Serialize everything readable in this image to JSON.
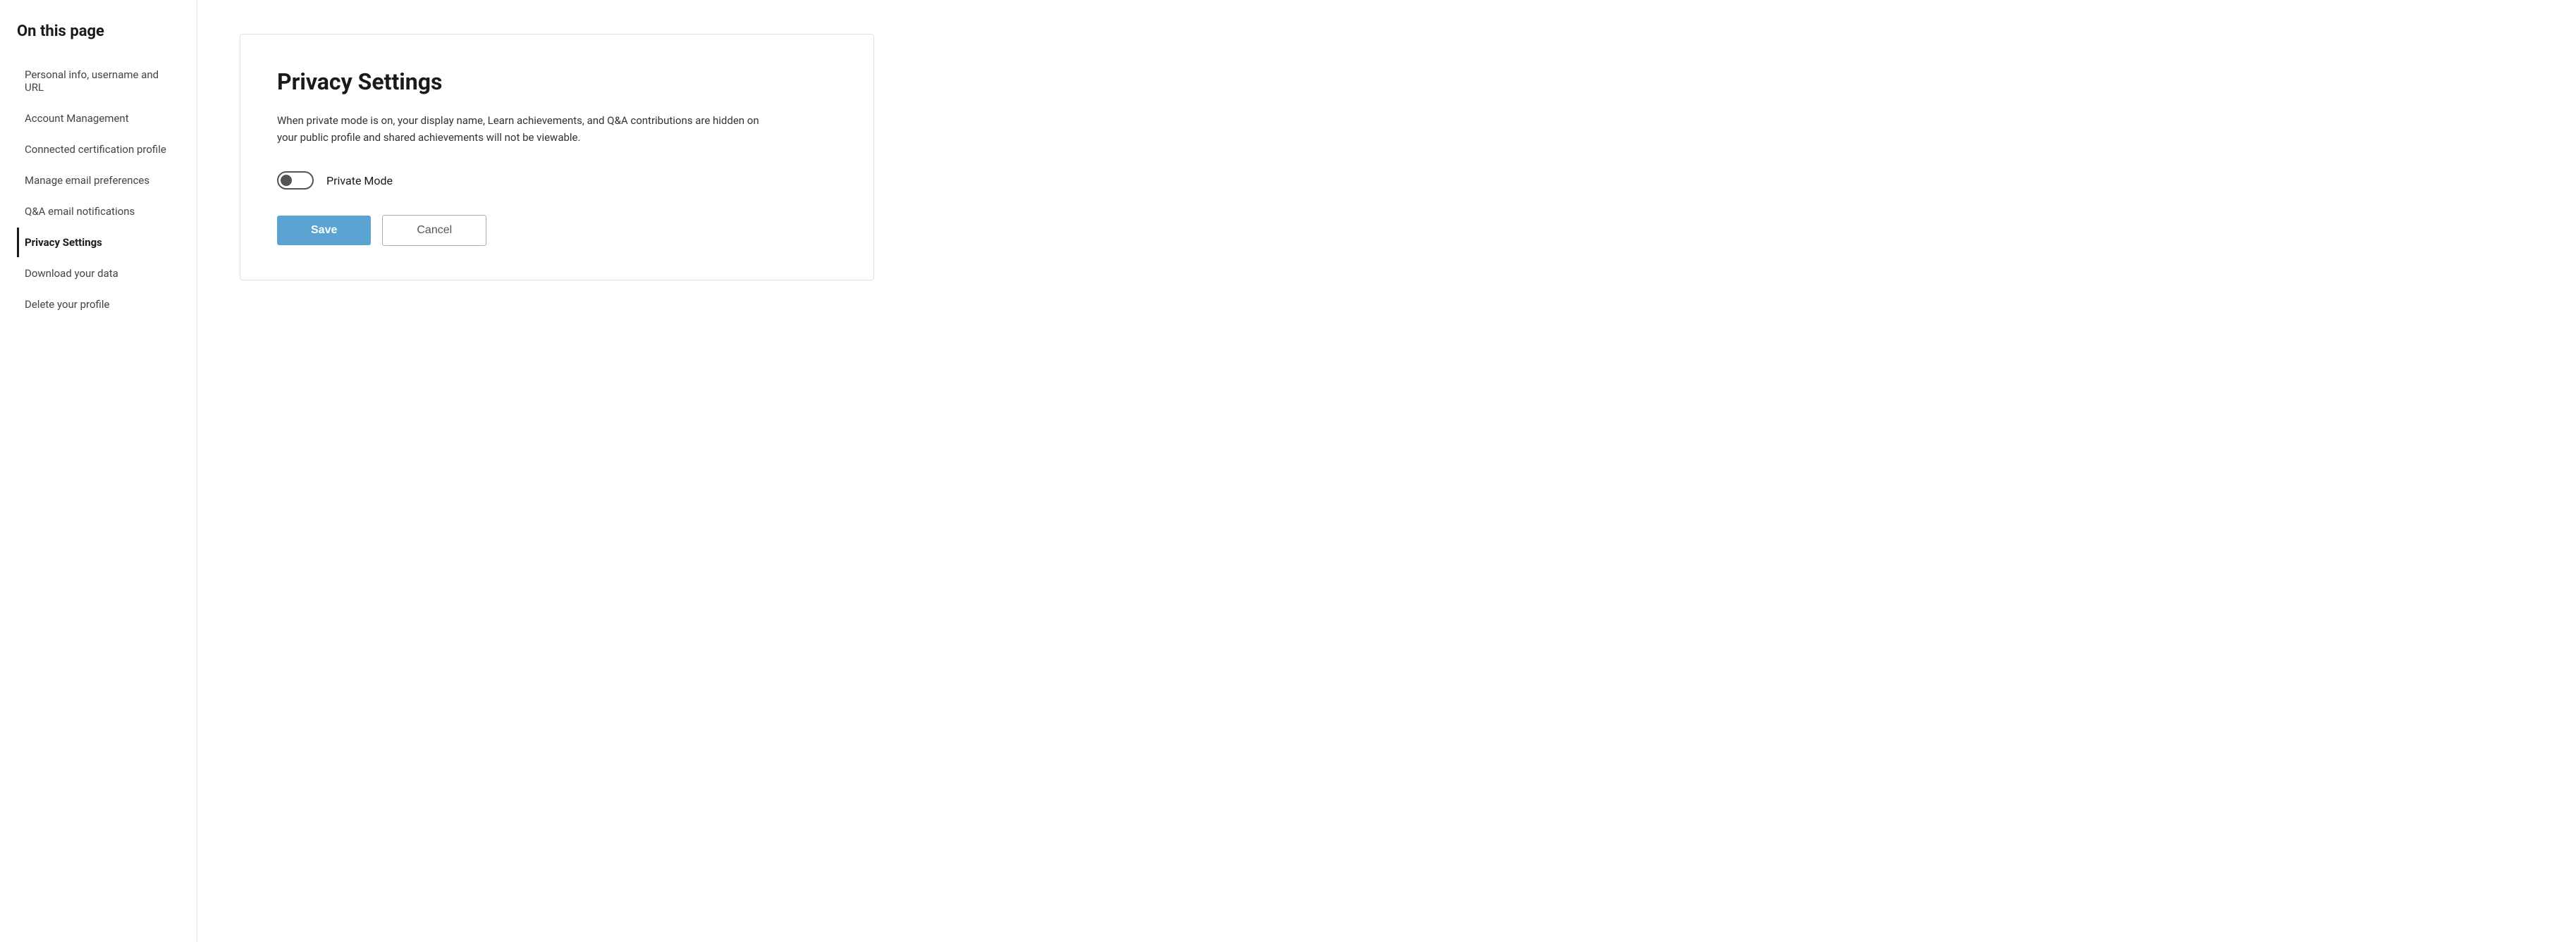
{
  "sidebar": {
    "title": "On this page",
    "nav_items": [
      {
        "id": "personal-info",
        "label": "Personal info, username and URL",
        "active": false
      },
      {
        "id": "account-management",
        "label": "Account Management",
        "active": false
      },
      {
        "id": "connected-cert",
        "label": "Connected certification profile",
        "active": false
      },
      {
        "id": "manage-email",
        "label": "Manage email preferences",
        "active": false
      },
      {
        "id": "qa-notifications",
        "label": "Q&A email notifications",
        "active": false
      },
      {
        "id": "privacy-settings",
        "label": "Privacy Settings",
        "active": true
      },
      {
        "id": "download-data",
        "label": "Download your data",
        "active": false
      },
      {
        "id": "delete-profile",
        "label": "Delete your profile",
        "active": false
      }
    ]
  },
  "main": {
    "section_title": "Privacy Settings",
    "description": "When private mode is on, your display name, Learn achievements, and Q&A contributions are hidden on your public profile and shared achievements will not be viewable.",
    "toggle_label": "Private Mode",
    "toggle_checked": false,
    "save_button": "Save",
    "cancel_button": "Cancel"
  }
}
